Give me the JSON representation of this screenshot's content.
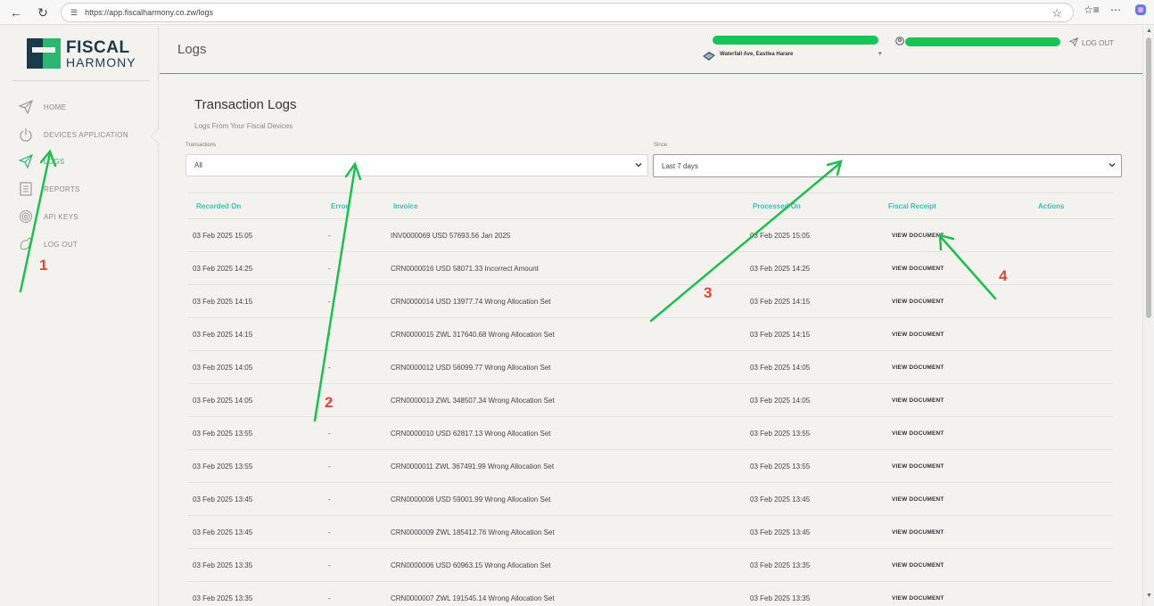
{
  "browser": {
    "url": "https://app.fiscalharmony.co.zw/logs"
  },
  "logo": {
    "line1": "FISCAL",
    "line2": "HARMONY"
  },
  "sidebar": {
    "items": [
      {
        "label": "HOME",
        "icon": "send-icon"
      },
      {
        "label": "DEVICES APPLICATION",
        "icon": "power-icon"
      },
      {
        "label": "LOGS",
        "icon": "send-icon",
        "active": true
      },
      {
        "label": "REPORTS",
        "icon": "document-icon"
      },
      {
        "label": "API KEYS",
        "icon": "fingerprint-icon"
      },
      {
        "label": "LOG OUT",
        "icon": "logout-icon"
      }
    ]
  },
  "header": {
    "title": "Logs",
    "address": "Waterfall Ave, Eastlea Harare",
    "logout_label": "LOG OUT"
  },
  "main": {
    "heading": "Transaction Logs",
    "subheading": "Logs From Your Fiscal Devices",
    "filters": {
      "transactions_label": "Transactions",
      "transactions_value": "All",
      "since_label": "Since",
      "since_value": "Last 7 days"
    },
    "table": {
      "columns": [
        "Recorded On",
        "Error",
        "Invoice",
        "Processed On",
        "Fiscal Receipt",
        "Actions"
      ],
      "rows": [
        {
          "recorded": "03 Feb 2025 15:05",
          "error": "-",
          "invoice": "INV0000069 USD 57693.56 Jan 2025",
          "processed": "03 Feb 2025 15:05",
          "receipt": "VIEW DOCUMENT"
        },
        {
          "recorded": "03 Feb 2025 14:25",
          "error": "-",
          "invoice": "CRN0000016 USD 58071.33 Incorrect Amount",
          "processed": "03 Feb 2025 14:25",
          "receipt": "VIEW DOCUMENT"
        },
        {
          "recorded": "03 Feb 2025 14:15",
          "error": "-",
          "invoice": "CRN0000014 USD 13977.74 Wrong Allocation Set",
          "processed": "03 Feb 2025 14:15",
          "receipt": "VIEW DOCUMENT"
        },
        {
          "recorded": "03 Feb 2025 14:15",
          "error": "-",
          "invoice": "CRN0000015 ZWL 317640.68 Wrong Allocation Set",
          "processed": "03 Feb 2025 14:15",
          "receipt": "VIEW DOCUMENT"
        },
        {
          "recorded": "03 Feb 2025 14:05",
          "error": "-",
          "invoice": "CRN0000012 USD 56099.77 Wrong Allocation Set",
          "processed": "03 Feb 2025 14:05",
          "receipt": "VIEW DOCUMENT"
        },
        {
          "recorded": "03 Feb 2025 14:05",
          "error": "-",
          "invoice": "CRN0000013 ZWL 348507.34 Wrong Allocation Set",
          "processed": "03 Feb 2025 14:05",
          "receipt": "VIEW DOCUMENT"
        },
        {
          "recorded": "03 Feb 2025 13:55",
          "error": "-",
          "invoice": "CRN0000010 USD 62817.13 Wrong Allocation Set",
          "processed": "03 Feb 2025 13:55",
          "receipt": "VIEW DOCUMENT"
        },
        {
          "recorded": "03 Feb 2025 13:55",
          "error": "-",
          "invoice": "CRN0000011 ZWL 367491.99 Wrong Allocation Set",
          "processed": "03 Feb 2025 13:55",
          "receipt": "VIEW DOCUMENT"
        },
        {
          "recorded": "03 Feb 2025 13:45",
          "error": "-",
          "invoice": "CRN0000008 USD 59001.99 Wrong Allocation Set",
          "processed": "03 Feb 2025 13:45",
          "receipt": "VIEW DOCUMENT"
        },
        {
          "recorded": "03 Feb 2025 13:45",
          "error": "-",
          "invoice": "CRN0000009 ZWL 185412.76 Wrong Allocation Set",
          "processed": "03 Feb 2025 13:45",
          "receipt": "VIEW DOCUMENT"
        },
        {
          "recorded": "03 Feb 2025 13:35",
          "error": "-",
          "invoice": "CRN0000006 USD 60963.15 Wrong Allocation Set",
          "processed": "03 Feb 2025 13:35",
          "receipt": "VIEW DOCUMENT"
        },
        {
          "recorded": "03 Feb 2025 13:35",
          "error": "-",
          "invoice": "CRN0000007 ZWL 191545.14 Wrong Allocation Set",
          "processed": "03 Feb 2025 13:35",
          "receipt": "VIEW DOCUMENT"
        }
      ]
    }
  },
  "annotations": {
    "labels": [
      "1",
      "2",
      "3",
      "4"
    ],
    "arrow_color": "#1fbf4f",
    "number_color": "#e0473a"
  },
  "colors": {
    "accent": "#2bb673",
    "header_teal": "#3cbfae",
    "brand_dark": "#1d3a4a"
  }
}
